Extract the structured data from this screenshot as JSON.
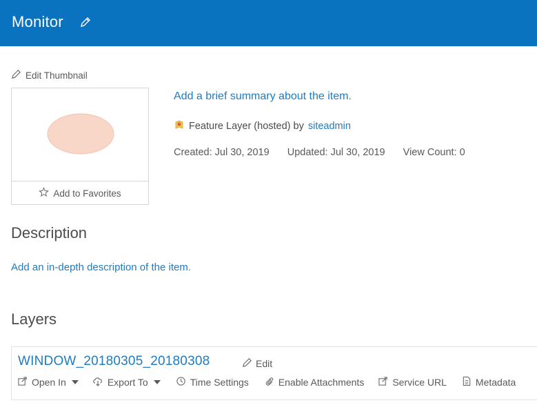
{
  "header": {
    "title": "Monitor"
  },
  "thumbnail": {
    "edit_label": "Edit Thumbnail",
    "favorites_label": "Add to Favorites"
  },
  "summary": {
    "placeholder_link": "Add a brief summary about the item.",
    "item_type": "Feature Layer (hosted) by",
    "owner": "siteadmin",
    "created": "Created: Jul 30, 2019",
    "updated": "Updated: Jul 30, 2019",
    "view_count": "View Count: 0"
  },
  "description": {
    "title": "Description",
    "placeholder_link": "Add an in-depth description of the item."
  },
  "layers": {
    "title": "Layers",
    "items": [
      {
        "name": "WINDOW_20180305_20180308",
        "edit_label": "Edit",
        "actions": {
          "open_in": "Open In",
          "export_to": "Export To",
          "time_settings": "Time Settings",
          "enable_attachments": "Enable Attachments",
          "service_url": "Service URL",
          "metadata": "Metadata"
        }
      }
    ]
  },
  "colors": {
    "header_bg": "#0a73c0",
    "link": "#1f7bc2",
    "thumbnail_shape": "#f8d6c8"
  },
  "icons": [
    "pencil-icon",
    "star-icon",
    "feature-layer-icon",
    "open-in-icon",
    "cloud-download-icon",
    "clock-icon",
    "paperclip-icon",
    "share-icon",
    "document-icon"
  ]
}
